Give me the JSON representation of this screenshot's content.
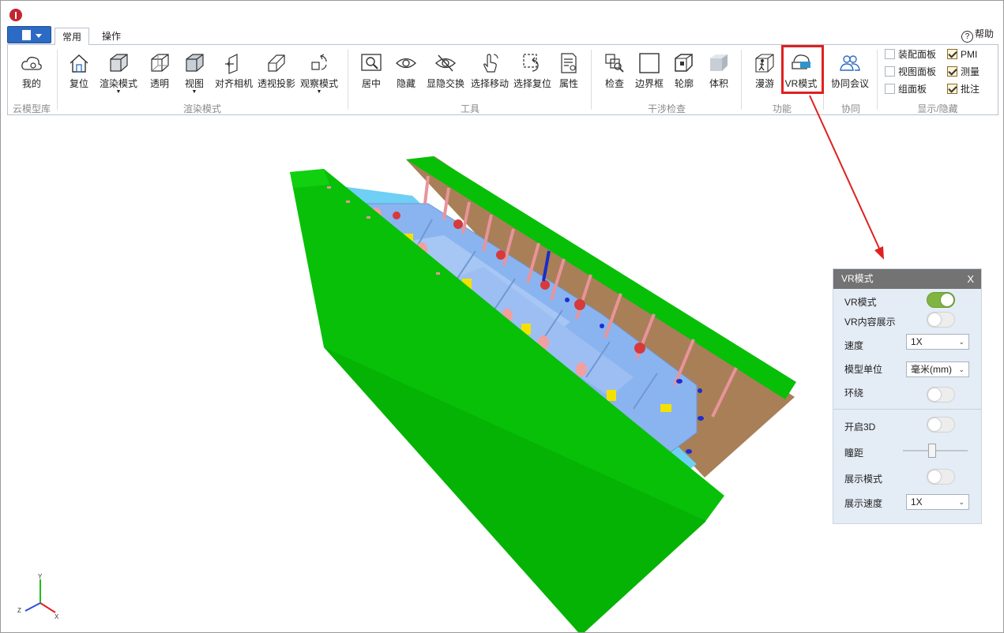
{
  "tabs": [
    {
      "label": "常用",
      "active": true
    },
    {
      "label": "操作",
      "active": false
    }
  ],
  "help_label": "帮助",
  "ribbon": {
    "groups": [
      {
        "label": "云模型库"
      },
      {
        "label": "渲染模式"
      },
      {
        "label": "工具"
      },
      {
        "label": "干涉检查"
      },
      {
        "label": "功能"
      },
      {
        "label": "协同"
      },
      {
        "label": "显示/隐藏"
      }
    ],
    "cloud": {
      "my_label": "我的"
    },
    "render": {
      "reset": "复位",
      "render_mode": "渲染模式",
      "transparent": "透明",
      "view": "视图",
      "align_camera": "对齐相机",
      "perspective": "透视投影",
      "observe_mode": "观察模式"
    },
    "tools": {
      "center": "居中",
      "hide": "隐藏",
      "swap_visibility": "显隐交换",
      "select_move": "选择移动",
      "select_reset": "选择复位",
      "properties": "属性"
    },
    "interference": {
      "check": "检查",
      "bounding_box": "边界框",
      "outline": "轮廓",
      "volume": "体积"
    },
    "features": {
      "walkthrough": "漫游",
      "vr_mode": "VR模式"
    },
    "collab": {
      "meeting": "协同会议"
    },
    "show_hide": {
      "items": [
        {
          "label": "装配面板",
          "checked": false
        },
        {
          "label": "视图面板",
          "checked": false
        },
        {
          "label": "组面板",
          "checked": false
        },
        {
          "label": "PMI",
          "checked": true
        },
        {
          "label": "测量",
          "checked": true
        },
        {
          "label": "批注",
          "checked": true
        }
      ]
    }
  },
  "vr_panel": {
    "title": "VR模式",
    "close": "X",
    "vr_mode_label": "VR模式",
    "vr_mode_on": true,
    "vr_content_label": "VR内容展示",
    "vr_content_on": false,
    "speed_label": "速度",
    "speed_value": "1X",
    "unit_label": "模型单位",
    "unit_value": "毫米(mm)",
    "orbit_label": "环绕",
    "orbit_on": false,
    "enable3d_label": "开启3D",
    "enable3d_on": false,
    "pupil_label": "瞳距",
    "pupil_level": 0.45,
    "display_mode_label": "展示模式",
    "display_mode_on": false,
    "display_speed_label": "展示速度",
    "display_speed_value": "1X"
  },
  "axes": {
    "x": "X",
    "y": "Y",
    "z": "Z"
  },
  "colors": {
    "accent_green": "#7fb540",
    "highlight_red": "#e02020",
    "model_green": "#00c000",
    "model_blue": "#8ab4f0"
  }
}
